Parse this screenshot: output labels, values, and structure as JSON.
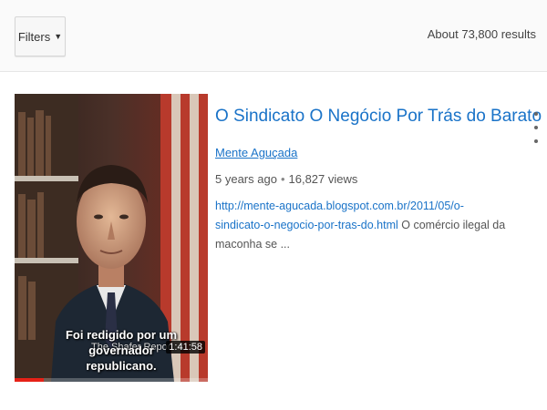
{
  "toolbar": {
    "filters_label": "Filters",
    "result_count": "About 73,800 results"
  },
  "result": {
    "title": "O Sindicato O Negócio Por Trás do Barato",
    "channel": "Mente Aguçada",
    "age": "5 years ago",
    "views": "16,827 views",
    "description_url": "http://mente-agucada.blogspot.com.br/2011/05/o-sindicato-o-negocio-por-tras-do.html",
    "description_text": " O comércio ilegal da maconha se ...",
    "thumbnail": {
      "caption": "Foi redigido por um governador republicano.",
      "subcaption": "The Shafer Report, 1",
      "duration": "1:41:58",
      "progress_fraction": 0.15
    },
    "menu_icon": "more-vertical-icon"
  },
  "colors": {
    "link": "#1a73c8",
    "progress": "#e62117"
  }
}
